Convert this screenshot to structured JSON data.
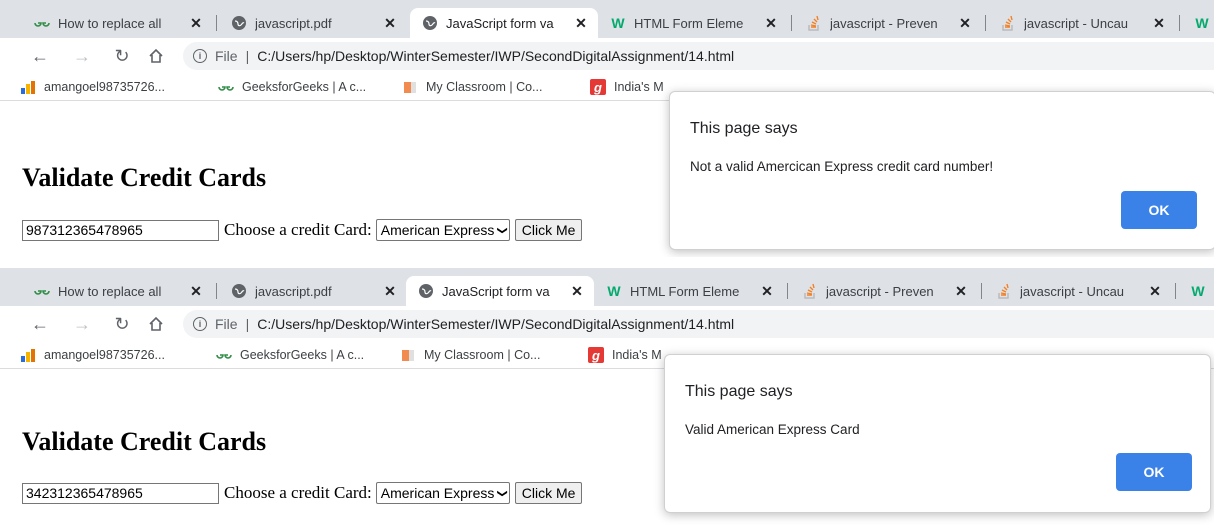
{
  "panels": [
    {
      "tabs": [
        {
          "label": "How to replace all",
          "icon": "geeksforgeeks-icon"
        },
        {
          "label": "javascript.pdf",
          "icon": "globe-icon"
        },
        {
          "label": "JavaScript form va",
          "icon": "globe-icon",
          "active": true
        },
        {
          "label": "HTML Form Eleme",
          "icon": "w3schools-icon"
        },
        {
          "label": "javascript - Preven",
          "icon": "stackoverflow-icon"
        },
        {
          "label": "javascript - Uncau",
          "icon": "stackoverflow-icon"
        }
      ],
      "address": {
        "scheme": "File",
        "url": "C:/Users/hp/Desktop/WinterSemester/IWP/SecondDigitalAssignment/14.html"
      },
      "bookmarks": [
        {
          "label": "amangoel98735726...",
          "icon": "analytics-icon"
        },
        {
          "label": "GeeksforGeeks | A c...",
          "icon": "geeksforgeeks-icon"
        },
        {
          "label": "My Classroom | Co...",
          "icon": "classroom-icon"
        },
        {
          "label": "India's M",
          "icon": "g-icon"
        }
      ],
      "page": {
        "title": "Validate Credit Cards",
        "card_number": "987312365478965",
        "choose_label": "Choose a credit Card:",
        "card_type": "American Express",
        "button_label": "Click Me"
      },
      "dialog": {
        "title": "This page says",
        "message": "Not a valid Amercican Express credit card number!",
        "ok_label": "OK"
      }
    },
    {
      "tabs": [
        {
          "label": "How to replace all",
          "icon": "geeksforgeeks-icon"
        },
        {
          "label": "javascript.pdf",
          "icon": "globe-icon"
        },
        {
          "label": "JavaScript form va",
          "icon": "globe-icon",
          "active": true
        },
        {
          "label": "HTML Form Eleme",
          "icon": "w3schools-icon"
        },
        {
          "label": "javascript - Preven",
          "icon": "stackoverflow-icon"
        },
        {
          "label": "javascript - Uncau",
          "icon": "stackoverflow-icon"
        }
      ],
      "address": {
        "scheme": "File",
        "url": "C:/Users/hp/Desktop/WinterSemester/IWP/SecondDigitalAssignment/14.html"
      },
      "bookmarks": [
        {
          "label": "amangoel98735726...",
          "icon": "analytics-icon"
        },
        {
          "label": "GeeksforGeeks | A c...",
          "icon": "geeksforgeeks-icon"
        },
        {
          "label": "My Classroom | Co...",
          "icon": "classroom-icon"
        },
        {
          "label": "India's M",
          "icon": "g-icon"
        }
      ],
      "page": {
        "title": "Validate Credit Cards",
        "card_number": "342312365478965",
        "choose_label": "Choose a credit Card:",
        "card_type": "American Express",
        "button_label": "Click Me"
      },
      "dialog": {
        "title": "This page says",
        "message": "Valid American Express Card",
        "ok_label": "OK"
      }
    }
  ]
}
